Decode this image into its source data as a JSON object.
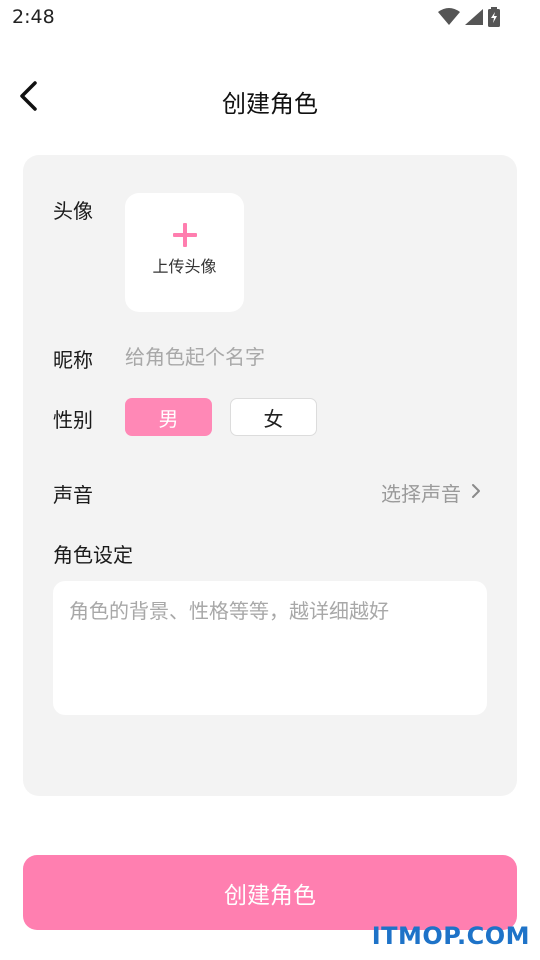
{
  "status_bar": {
    "time": "2:48"
  },
  "header": {
    "title": "创建角色"
  },
  "form": {
    "avatar": {
      "label": "头像",
      "upload_text": "上传头像"
    },
    "nickname": {
      "label": "昵称",
      "placeholder": "给角色起个名字",
      "value": ""
    },
    "gender": {
      "label": "性别",
      "options": [
        "男",
        "女"
      ],
      "selected": "男"
    },
    "voice": {
      "label": "声音",
      "placeholder": "选择声音"
    },
    "setting": {
      "label": "角色设定",
      "placeholder": "角色的背景、性格等等，越详细越好",
      "value": ""
    }
  },
  "submit": {
    "label": "创建角色"
  },
  "watermark": "ITMOP.COM",
  "colors": {
    "accent": "#ff7fb0",
    "card_bg": "#f3f3f3",
    "placeholder": "#a8a8a8"
  }
}
